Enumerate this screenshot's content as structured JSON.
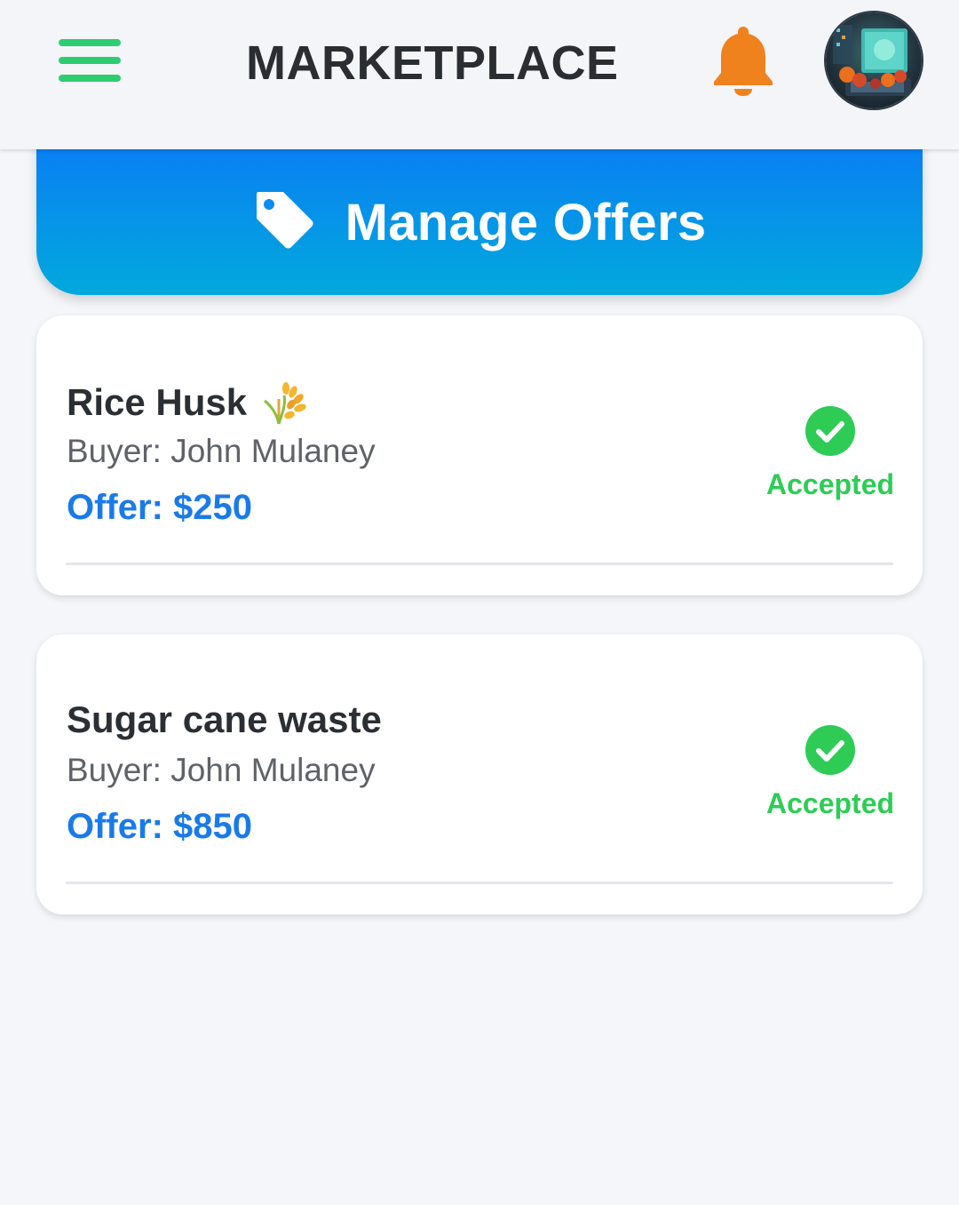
{
  "header": {
    "title": "MARKETPLACE",
    "menu_icon": "hamburger-menu-icon",
    "notification_icon": "bell-icon",
    "avatar_icon": "user-avatar",
    "colors": {
      "menu": "#2ecc71",
      "bell": "#f0821e",
      "title": "#2a2e33"
    }
  },
  "banner": {
    "icon": "tag-icon",
    "title": "Manage Offers",
    "colors": {
      "top": "#0a7cf5",
      "bottom": "#02a9dc"
    }
  },
  "offers": [
    {
      "name": "Rice Husk",
      "icon": "rice-sheaf-emoji",
      "buyer": "Buyer: John Mulaney",
      "offer": "Offer: $250",
      "status": "Accepted",
      "status_icon": "check-circle-icon"
    },
    {
      "name": "Sugar cane waste",
      "buyer": "Buyer: John Mulaney",
      "offer": "Offer: $850",
      "status": "Accepted",
      "status_icon": "check-circle-icon"
    }
  ],
  "colors": {
    "offer_text": "#1a7ae8",
    "accepted": "#2ecc55",
    "background": "#f4f6fa"
  }
}
